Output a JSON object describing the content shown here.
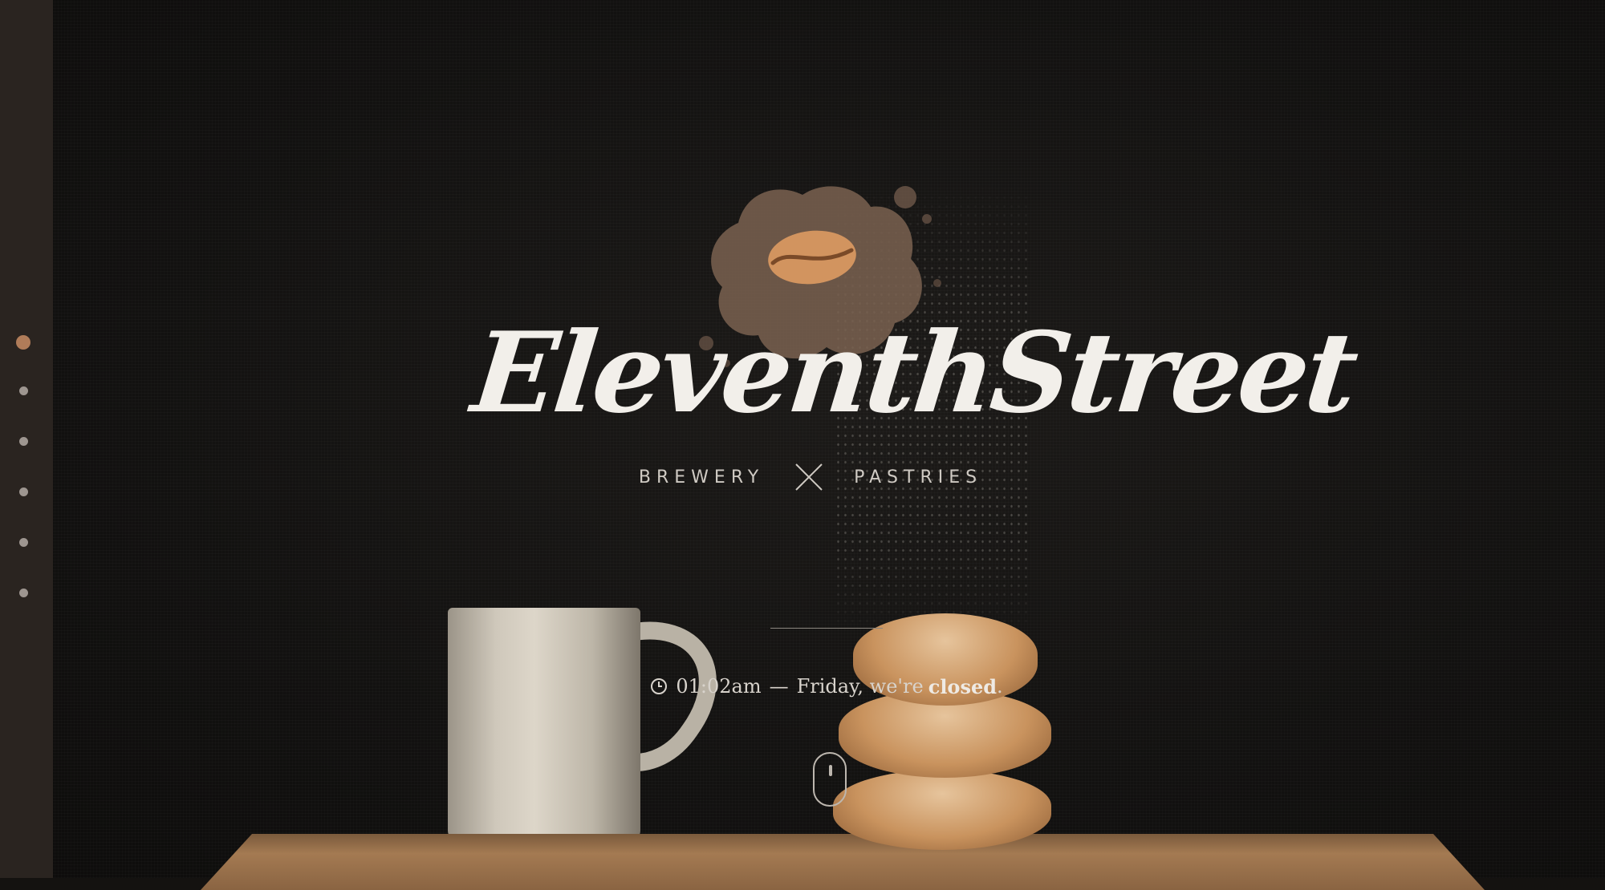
{
  "brand": {
    "name": "EleventhStreet",
    "tagline_left": "BREWERY",
    "tagline_right": "PASTRIES"
  },
  "sidebar": {
    "nav_dots": [
      {
        "name": "section-1",
        "active": true
      },
      {
        "name": "section-2",
        "active": false
      },
      {
        "name": "section-3",
        "active": false
      },
      {
        "name": "section-4",
        "active": false
      },
      {
        "name": "section-5",
        "active": false
      },
      {
        "name": "section-6",
        "active": false
      }
    ]
  },
  "status": {
    "icon": "clock-icon",
    "time": "01:02am",
    "separator": "—",
    "day": "Friday, we're",
    "state": "closed",
    "suffix": "."
  },
  "scroll_hint": {
    "icon": "mouse-scroll-icon"
  },
  "colors": {
    "accent": "#b07c59",
    "background": "#141210",
    "sidebar": "#2a2420",
    "text": "#f2efea"
  }
}
